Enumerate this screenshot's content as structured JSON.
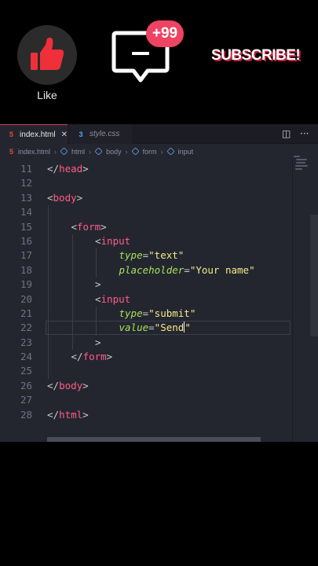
{
  "promo": {
    "like_label": "Like",
    "badge": "+99",
    "subscribe": "SUBSCRIBE!"
  },
  "tabs": [
    {
      "icon": "html5-icon",
      "label": "index.html",
      "active": true
    },
    {
      "icon": "css-icon",
      "label": "style.css",
      "active": false
    }
  ],
  "breadcrumb": [
    "index.html",
    "html",
    "body",
    "form",
    "input"
  ],
  "code": {
    "current_line": 22,
    "lines": [
      {
        "n": "11",
        "indent": 0,
        "text": "</head>"
      },
      {
        "n": "12",
        "indent": 0,
        "text": ""
      },
      {
        "n": "13",
        "indent": 0,
        "text": "<body>"
      },
      {
        "n": "14",
        "indent": 0,
        "text": ""
      },
      {
        "n": "15",
        "indent": 1,
        "text": "<form>"
      },
      {
        "n": "16",
        "indent": 2,
        "text": "<input"
      },
      {
        "n": "17",
        "indent": 3,
        "text": "type=\"text\""
      },
      {
        "n": "18",
        "indent": 3,
        "text": "placeholder=\"Your name\""
      },
      {
        "n": "19",
        "indent": 2,
        "text": ">"
      },
      {
        "n": "20",
        "indent": 2,
        "text": "<input"
      },
      {
        "n": "21",
        "indent": 3,
        "text": "type=\"submit\""
      },
      {
        "n": "22",
        "indent": 3,
        "text": "value=\"Send\""
      },
      {
        "n": "23",
        "indent": 2,
        "text": ">"
      },
      {
        "n": "24",
        "indent": 1,
        "text": "</form>"
      },
      {
        "n": "25",
        "indent": 0,
        "text": ""
      },
      {
        "n": "26",
        "indent": 0,
        "text": "</body>"
      },
      {
        "n": "27",
        "indent": 0,
        "text": ""
      },
      {
        "n": "28",
        "indent": 0,
        "text": "</html>"
      }
    ]
  },
  "colors": {
    "accent_red": "#ee4363",
    "editor_bg": "#24262f",
    "tag": "#ff5c87",
    "attr": "#a5e05a",
    "string": "#f3e98d"
  }
}
